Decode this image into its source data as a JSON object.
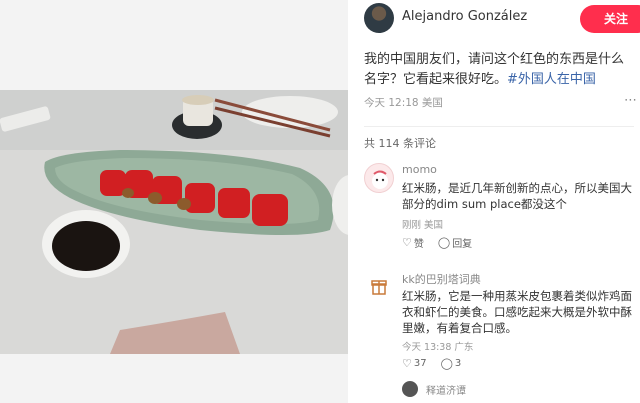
{
  "author": {
    "name": "Alejandro González",
    "follow_label": "关注"
  },
  "post": {
    "text": "我的中国朋友们，请问这个红色的东西是什么名字？它看起来很好吃。",
    "hashtag": "#外国人在中国",
    "meta": "今天 12:18 美国",
    "more_icon": "ellipsis-icon"
  },
  "comments_summary": {
    "count_label": "共 114 条评论"
  },
  "comments": [
    {
      "name": "momo",
      "text": "红米肠，是近几年新创新的点心，所以美国大部分的dim sum place都没这个",
      "time": "刚刚 美国",
      "like_label": "赞",
      "reply_label": "回复"
    },
    {
      "name": "kk的巴别塔词典",
      "text": "红米肠，它是一种用蒸米皮包裹着类似炸鸡面衣和虾仁的美食。口感吃起来大概是外软中酥里嫩，有着复合口感。",
      "time": "今天 13:38 广东",
      "like_count": "37",
      "reply_count": "3"
    }
  ],
  "reply_preview": {
    "name": "释道济谭"
  },
  "colors": {
    "accent": "#ff2e4d",
    "hashtag": "#3a64a8"
  }
}
